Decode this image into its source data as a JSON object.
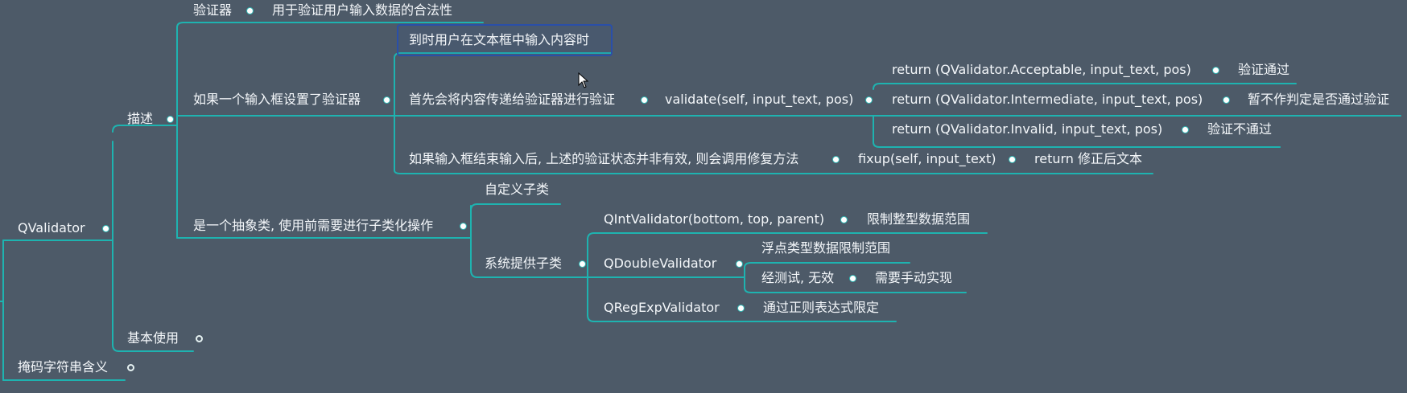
{
  "colors": {
    "background": "#4d5a68",
    "branch": "#1eb3b0",
    "selection": "#2a4fa8",
    "text": "#f4f7fa"
  },
  "root": {
    "label": "QValidator"
  },
  "level1": {
    "describe": "描述",
    "basic_use": "基本使用",
    "mask_meaning": "掩码字符串含义"
  },
  "describe": {
    "validator": "验证器",
    "validator_desc": "用于验证用户输入数据的合法性",
    "if_set": "如果一个输入框设置了验证器",
    "abstract": "是一个抽象类, 使用前需要进行子类化操作"
  },
  "flow": {
    "when_input": "到时用户在文本框中输入内容时",
    "first_validate": "首先会将内容传递给验证器进行验证",
    "validate_fn": "validate(self, input_text, pos)",
    "return_acceptable": "return (QValidator.Acceptable,  input_text, pos)",
    "acceptable_desc": "验证通过",
    "return_intermediate": "return (QValidator.Intermediate,  input_text, pos)",
    "intermediate_desc": "暂不作判定是否通过验证",
    "return_invalid": "return (QValidator.Invalid,  input_text, pos)",
    "invalid_desc": "验证不通过",
    "if_end": "如果输入框结束输入后, 上述的验证状态并非有效, 则会调用修复方法",
    "fixup_fn": "fixup(self, input_text)",
    "fixup_return": "return 修正后文本"
  },
  "subclass": {
    "custom": "自定义子类",
    "system": "系统提供子类",
    "int_validator": "QIntValidator(bottom, top, parent)",
    "int_desc": "限制整型数据范围",
    "double_validator": "QDoubleValidator",
    "double_desc1": "浮点类型数据限制范围",
    "double_desc2": "经测试, 无效",
    "double_desc3": "需要手动实现",
    "regexp_validator": "QRegExpValidator",
    "regexp_desc": "通过正则表达式限定"
  }
}
